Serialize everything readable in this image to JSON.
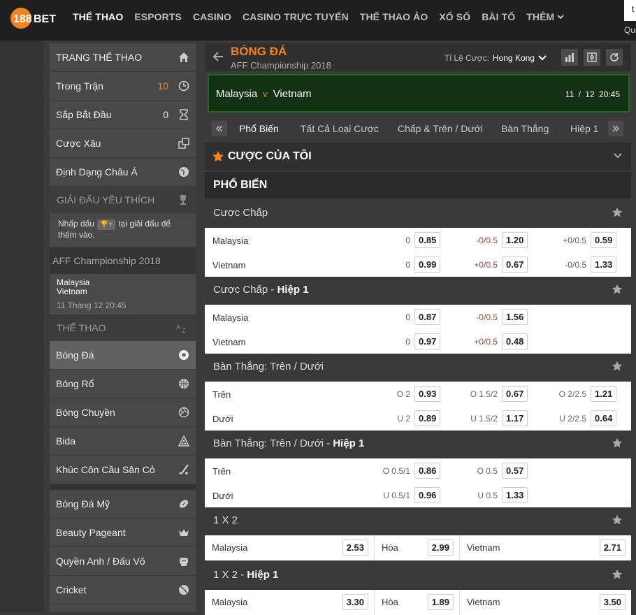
{
  "brand": {
    "logo_text": "188BET",
    "accent": "#f6821f"
  },
  "nav": {
    "items": [
      "THỂ THAO",
      "ESPORTS",
      "CASINO",
      "CASINO TRỰC TUYẾN",
      "THỂ THAO ẢO",
      "XỔ SỐ",
      "BÀI TỐ",
      "THÊM"
    ]
  },
  "topright": {
    "box_text": "t",
    "label": "Que"
  },
  "sidebar": {
    "home": "TRANG THỂ THAO",
    "inplay": {
      "label": "Trong Trận",
      "count": "10"
    },
    "upcoming": {
      "label": "Sắp Bắt Đầu",
      "count": "0"
    },
    "parlay": "Cược Xâu",
    "asian": "Định Dạng Châu Á",
    "fav_header": "GIẢI ĐẤU YÊU THÍCH",
    "fav_note_a": "Nhấp dấu",
    "fav_note_plus": "🏆+",
    "fav_note_b": "tại giải đấu để thêm vào.",
    "league": "AFF Championship 2018",
    "match": {
      "home": "Malaysia",
      "away": "Vietnam",
      "time": "11 Tháng 12 20:45"
    },
    "sports_header": "THỂ THAO",
    "sports": [
      "Bóng Đá",
      "Bóng Rổ",
      "Bóng Chuyền",
      "Bida",
      "Khúc Côn Cầu Sân Cỏ"
    ],
    "sports2": [
      "Bóng Đá Mỹ",
      "Beauty Pageant",
      "Quyền Anh / Đấu Võ",
      "Cricket"
    ]
  },
  "main": {
    "title": "BÓNG ĐÁ",
    "subtitle": "AFF Championship 2018",
    "odds_label": "Tỉ Lệ Cược:",
    "odds_value": "Hong Kong",
    "match": {
      "home": "Malaysia",
      "v": "v",
      "away": "Vietnam",
      "date": "11 / 12",
      "time": "20:45"
    },
    "tabs": [
      "Phổ Biến",
      "Tất Cả Loại Cược",
      "Chấp & Trên / Dưới",
      "Bàn Thắng",
      "Hiệp 1"
    ],
    "my_bets": "CƯỢC CỦA TÔI",
    "popular": "PHỔ BIẾN",
    "groups": [
      {
        "title": "Cược Chấp",
        "bold": "",
        "rows": [
          {
            "name": "Malaysia",
            "c": [
              {
                "h": "0",
                "o": "0.85"
              },
              {
                "h": "-0/0.5",
                "o": "1.20"
              },
              {
                "h": "+0/0.5",
                "o": "0.59"
              }
            ]
          },
          {
            "name": "Vietnam",
            "c": [
              {
                "h": "0",
                "o": "0.99"
              },
              {
                "h": "+0/0.5",
                "o": "0.67"
              },
              {
                "h": "-0/0.5",
                "o": "1.33"
              }
            ]
          }
        ]
      },
      {
        "title": "Cược Chấp - ",
        "bold": "Hiệp 1",
        "rows": [
          {
            "name": "Malaysia",
            "c": [
              {
                "h": "0",
                "o": "0.87"
              },
              {
                "h": "-0/0.5",
                "o": "1.56"
              }
            ]
          },
          {
            "name": "Vietnam",
            "c": [
              {
                "h": "0",
                "o": "0.97"
              },
              {
                "h": "+0/0.5",
                "o": "0.48"
              }
            ]
          }
        ]
      },
      {
        "title": "Bàn Thắng: Trên / Dưới",
        "bold": "",
        "rows": [
          {
            "name": "Trên",
            "c": [
              {
                "h": "O 2",
                "o": "0.93"
              },
              {
                "h": "O 1.5/2",
                "o": "0.67"
              },
              {
                "h": "O 2/2.5",
                "o": "1.21"
              }
            ]
          },
          {
            "name": "Dưới",
            "c": [
              {
                "h": "U 2",
                "o": "0.89"
              },
              {
                "h": "U 1.5/2",
                "o": "1.17"
              },
              {
                "h": "U 2/2.5",
                "o": "0.64"
              }
            ]
          }
        ]
      },
      {
        "title": "Bàn Thắng: Trên / Dưới - ",
        "bold": "Hiệp 1",
        "rows": [
          {
            "name": "Trên",
            "c": [
              {
                "h": "O 0.5/1",
                "o": "0.86"
              },
              {
                "h": "O 0.5",
                "o": "0.57"
              }
            ]
          },
          {
            "name": "Dưới",
            "c": [
              {
                "h": "U 0.5/1",
                "o": "0.96"
              },
              {
                "h": "U 0.5",
                "o": "1.33"
              }
            ]
          }
        ]
      }
    ],
    "x2": [
      {
        "title": "1 X 2",
        "bold": "",
        "cells": [
          {
            "l": "Malaysia",
            "o": "2.53"
          },
          {
            "l": "Hòa",
            "o": "2.99"
          },
          {
            "l": "Vietnam",
            "o": "2.71"
          }
        ]
      },
      {
        "title": "1 X 2 - ",
        "bold": "Hiệp 1",
        "cells": [
          {
            "l": "Malaysia",
            "o": "3.30"
          },
          {
            "l": "Hòa",
            "o": "1.89"
          },
          {
            "l": "Vietnam",
            "o": "3.50"
          }
        ]
      }
    ]
  }
}
